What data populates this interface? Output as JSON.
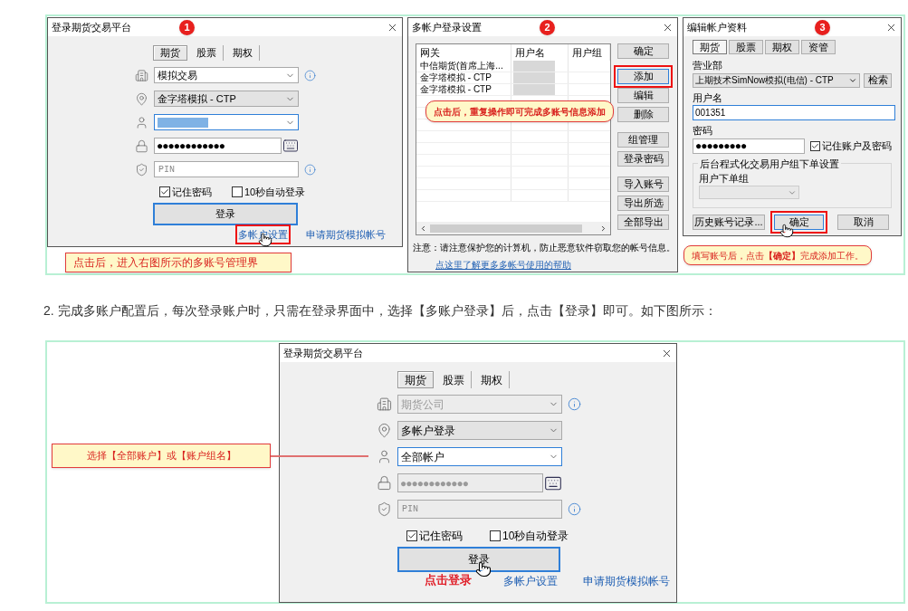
{
  "figure_1": {
    "login_dialog": {
      "title": "登录期货交易平台",
      "badge": "1",
      "tabs": [
        {
          "label": "期货",
          "selected": true
        },
        {
          "label": "股票",
          "selected": false
        },
        {
          "label": "期权",
          "selected": false
        }
      ],
      "fields": [
        {
          "kind": "dropdown",
          "value": "模拟交易",
          "disabled": false,
          "focused": false,
          "info": true
        },
        {
          "kind": "combo",
          "value": "金字塔模拟 - CTP",
          "disabled": false,
          "focused": false,
          "info": false
        },
        {
          "kind": "dropdown",
          "redacted": true,
          "disabled": false,
          "focused": true,
          "info": false
        },
        {
          "kind": "password",
          "value": "●●●●●●●●●●●●",
          "disabled": false,
          "focused": false,
          "info": false
        },
        {
          "kind": "text",
          "placeholder": "PIN",
          "disabled": false,
          "focused": false,
          "info": true
        }
      ],
      "checkboxes": [
        {
          "label": "记住密码",
          "checked": true
        },
        {
          "label": "10秒自动登录",
          "checked": false
        }
      ],
      "login_button": "登录",
      "links": [
        {
          "label": "多帐户设置",
          "highlighted": true
        },
        {
          "label": "申请期货模拟帐号",
          "highlighted": false
        }
      ],
      "callout": "点击后，进入右图所示的多账号管理界"
    },
    "multi_account_dialog": {
      "title": "多帐户登录设置",
      "badge": "2",
      "columns": [
        "网关",
        "用户名",
        "用户组"
      ],
      "rows": [
        {
          "gateway": "中信期货(首席上海...",
          "redacted": true
        },
        {
          "gateway": "金字塔模拟 - CTP",
          "redacted": true
        },
        {
          "gateway": "金字塔模拟 - CTP",
          "redacted": true
        }
      ],
      "button_groups": [
        [
          {
            "label": "确定",
            "highlighted": false
          }
        ],
        [
          {
            "label": "添加",
            "highlighted": true
          },
          {
            "label": "编辑",
            "highlighted": false
          },
          {
            "label": "删除",
            "highlighted": false
          }
        ],
        [
          {
            "label": "组管理",
            "highlighted": false
          },
          {
            "label": "登录密码",
            "highlighted": false
          }
        ],
        [
          {
            "label": "导入账号",
            "highlighted": false
          },
          {
            "label": "导出所选",
            "highlighted": false
          },
          {
            "label": "全部导出",
            "highlighted": false
          }
        ]
      ],
      "note": "注意：请注意保护您的计算机，防止恶意软件窃取您的帐号信息。",
      "help_link": "点这里了解更多多帐号使用的帮助",
      "callout": "点击后，重复操作即可完成多账号信息添加"
    },
    "edit_account_dialog": {
      "title": "编辑帐户资料",
      "badge": "3",
      "tabs": [
        {
          "label": "期货",
          "selected": true
        },
        {
          "label": "股票",
          "selected": false
        },
        {
          "label": "期权",
          "selected": false
        },
        {
          "label": "资管",
          "selected": false
        }
      ],
      "branch_label": "营业部",
      "branch_value": "上期技术SimNow模拟(电信) - CTP",
      "search_button": "检索",
      "username_label": "用户名",
      "username_value": "001351",
      "password_label": "密码",
      "password_value": "●●●●●●●●●",
      "remember": {
        "label": "记住账户及密码",
        "checked": true
      },
      "group_title": "后台程式化交易用户组下单设置",
      "order_group_label": "用户下单组",
      "buttons": [
        {
          "label": "历史账号记录...",
          "highlighted": false
        },
        {
          "label": "确定",
          "highlighted": true
        },
        {
          "label": "取消",
          "highlighted": false
        }
      ],
      "callout": "填写账号后，点击**【确定】**完成添加工作。"
    }
  },
  "paragraph": "2. 完成多账户配置后，每次登录账户时，只需在登录界面中，选择【多账户登录】后，点击【登录】即可。如下图所示：",
  "figure_2": {
    "callout": "选择【全部账户】或【账户组名】",
    "login_dialog": {
      "title": "登录期货交易平台",
      "tabs": [
        {
          "label": "期货",
          "selected": true
        },
        {
          "label": "股票",
          "selected": false
        },
        {
          "label": "期权",
          "selected": false
        }
      ],
      "fields": [
        {
          "kind": "dropdown",
          "value": "期货公司",
          "disabled": true,
          "focused": false,
          "info": true
        },
        {
          "kind": "combo",
          "value": "多帐户登录",
          "disabled": false,
          "focused": false,
          "info": false
        },
        {
          "kind": "dropdown",
          "value": "全部帐户",
          "disabled": false,
          "focused": true,
          "info": false
        },
        {
          "kind": "password",
          "value": "●●●●●●●●●●●●",
          "disabled": true,
          "focused": false,
          "info": false
        },
        {
          "kind": "text",
          "placeholder": "PIN",
          "disabled": true,
          "focused": false,
          "info": true
        }
      ],
      "checkboxes": [
        {
          "label": "记住密码",
          "checked": true
        },
        {
          "label": "10秒自动登录",
          "checked": false
        }
      ],
      "login_button": "登录",
      "annotation": "点击登录",
      "links": [
        {
          "label": "多帐户设置",
          "highlighted": false
        },
        {
          "label": "申请期货模拟帐号",
          "highlighted": false
        }
      ]
    }
  }
}
